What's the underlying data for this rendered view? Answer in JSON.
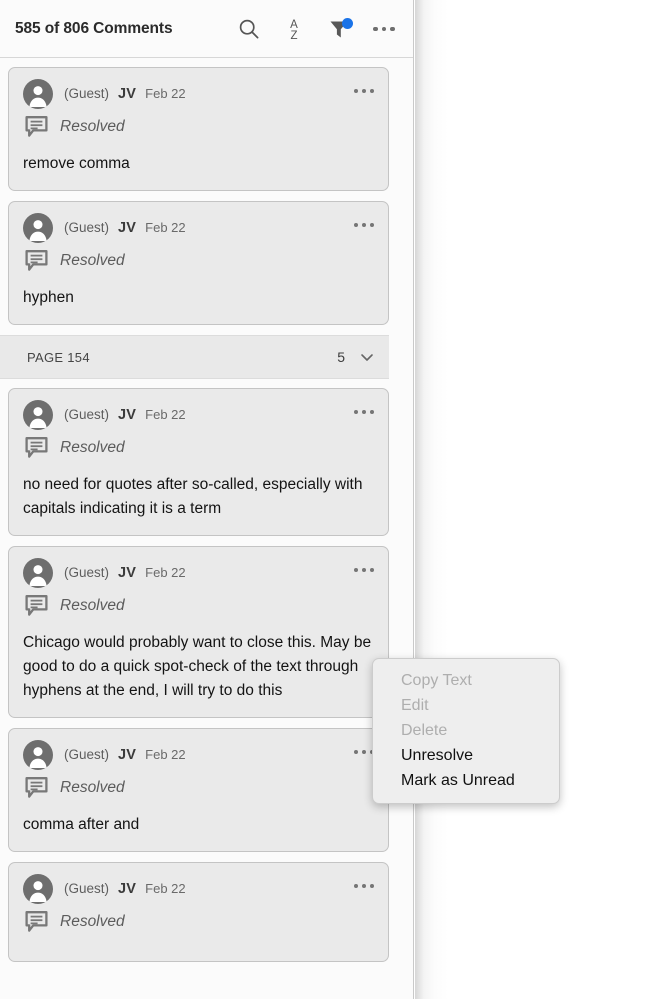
{
  "header": {
    "title": "585 of 806 Comments",
    "icons": [
      {
        "name": "search-icon",
        "label": "Search"
      },
      {
        "name": "sort-az-icon",
        "label": "Sort A to Z"
      },
      {
        "name": "filter-icon",
        "label": "Filter",
        "badge": true,
        "badge_color": "#1a73e8"
      },
      {
        "name": "more-options-icon",
        "label": "More options"
      }
    ]
  },
  "colors": {
    "panel_background": "#fbfbfb",
    "card_background": "#eaeaea",
    "card_border": "#c4c4c4",
    "accent": "#1a73e8",
    "avatar": "#6e6e6e",
    "menu_background": "#eeeeee"
  },
  "comments": [
    {
      "author": "(Guest)",
      "initials": "JV",
      "date": "Feb 22",
      "status": "Resolved",
      "body": "remove comma"
    },
    {
      "author": "(Guest)",
      "initials": "JV",
      "date": "Feb 22",
      "status": "Resolved",
      "body": "hyphen"
    },
    {
      "author": "(Guest)",
      "initials": "JV",
      "date": "Feb 22",
      "status": "Resolved",
      "body": "no need for quotes after so-called, especially with capitals indicating it is a term"
    },
    {
      "author": "(Guest)",
      "initials": "JV",
      "date": "Feb 22",
      "status": "Resolved",
      "body": "Chicago would probably want to close this. May be good to do a quick spot-check of the text through hyphens at the end, I will try to do this"
    },
    {
      "author": "(Guest)",
      "initials": "JV",
      "date": "Feb 22",
      "status": "Resolved",
      "body": "comma after and"
    },
    {
      "author": "(Guest)",
      "initials": "JV",
      "date": "Feb 22",
      "status": "Resolved",
      "body": ""
    }
  ],
  "page_divider": {
    "label": "PAGE 154",
    "count": "5"
  },
  "context_menu": {
    "items": [
      {
        "label": "Copy Text",
        "disabled": true
      },
      {
        "label": "Edit",
        "disabled": true
      },
      {
        "label": "Delete",
        "disabled": true
      },
      {
        "label": "Unresolve",
        "disabled": false
      },
      {
        "label": "Mark as Unread",
        "disabled": false
      }
    ]
  }
}
